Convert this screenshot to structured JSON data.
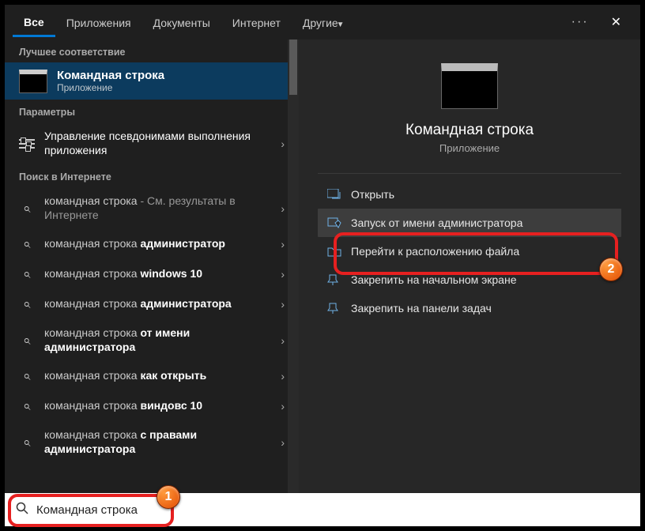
{
  "tabs": {
    "all": "Все",
    "apps": "Приложения",
    "docs": "Документы",
    "web": "Интернет",
    "more": "Другие"
  },
  "more_btn": "···",
  "close_btn": "✕",
  "sections": {
    "best": "Лучшее соответствие",
    "params": "Параметры",
    "web": "Поиск в Интернете"
  },
  "best_match": {
    "title": "Командная строка",
    "subtitle": "Приложение"
  },
  "settings_row": "Управление псевдонимами выполнения приложения",
  "web_items": [
    {
      "pre": "командная строка",
      "bold": "",
      "suf": " - См. результаты в Интернете"
    },
    {
      "pre": "командная строка ",
      "bold": "администратор",
      "suf": ""
    },
    {
      "pre": "командная строка ",
      "bold": "windows 10",
      "suf": ""
    },
    {
      "pre": "командная строка ",
      "bold": "администратора",
      "suf": ""
    },
    {
      "pre": "командная строка ",
      "bold": "от имени администратора",
      "suf": ""
    },
    {
      "pre": "командная строка ",
      "bold": "как открыть",
      "suf": ""
    },
    {
      "pre": "командная строка ",
      "bold": "виндовс 10",
      "suf": ""
    },
    {
      "pre": "командная строка ",
      "bold": "с правами администратора",
      "suf": ""
    }
  ],
  "preview": {
    "title": "Командная строка",
    "subtitle": "Приложение"
  },
  "actions": {
    "open": "Открыть",
    "run_admin": "Запуск от имени администратора",
    "open_loc": "Перейти к расположению файла",
    "pin_start": "Закрепить на начальном экране",
    "pin_task": "Закрепить на панели задач"
  },
  "search_value": "Командная строка",
  "badges": {
    "b1": "1",
    "b2": "2"
  }
}
